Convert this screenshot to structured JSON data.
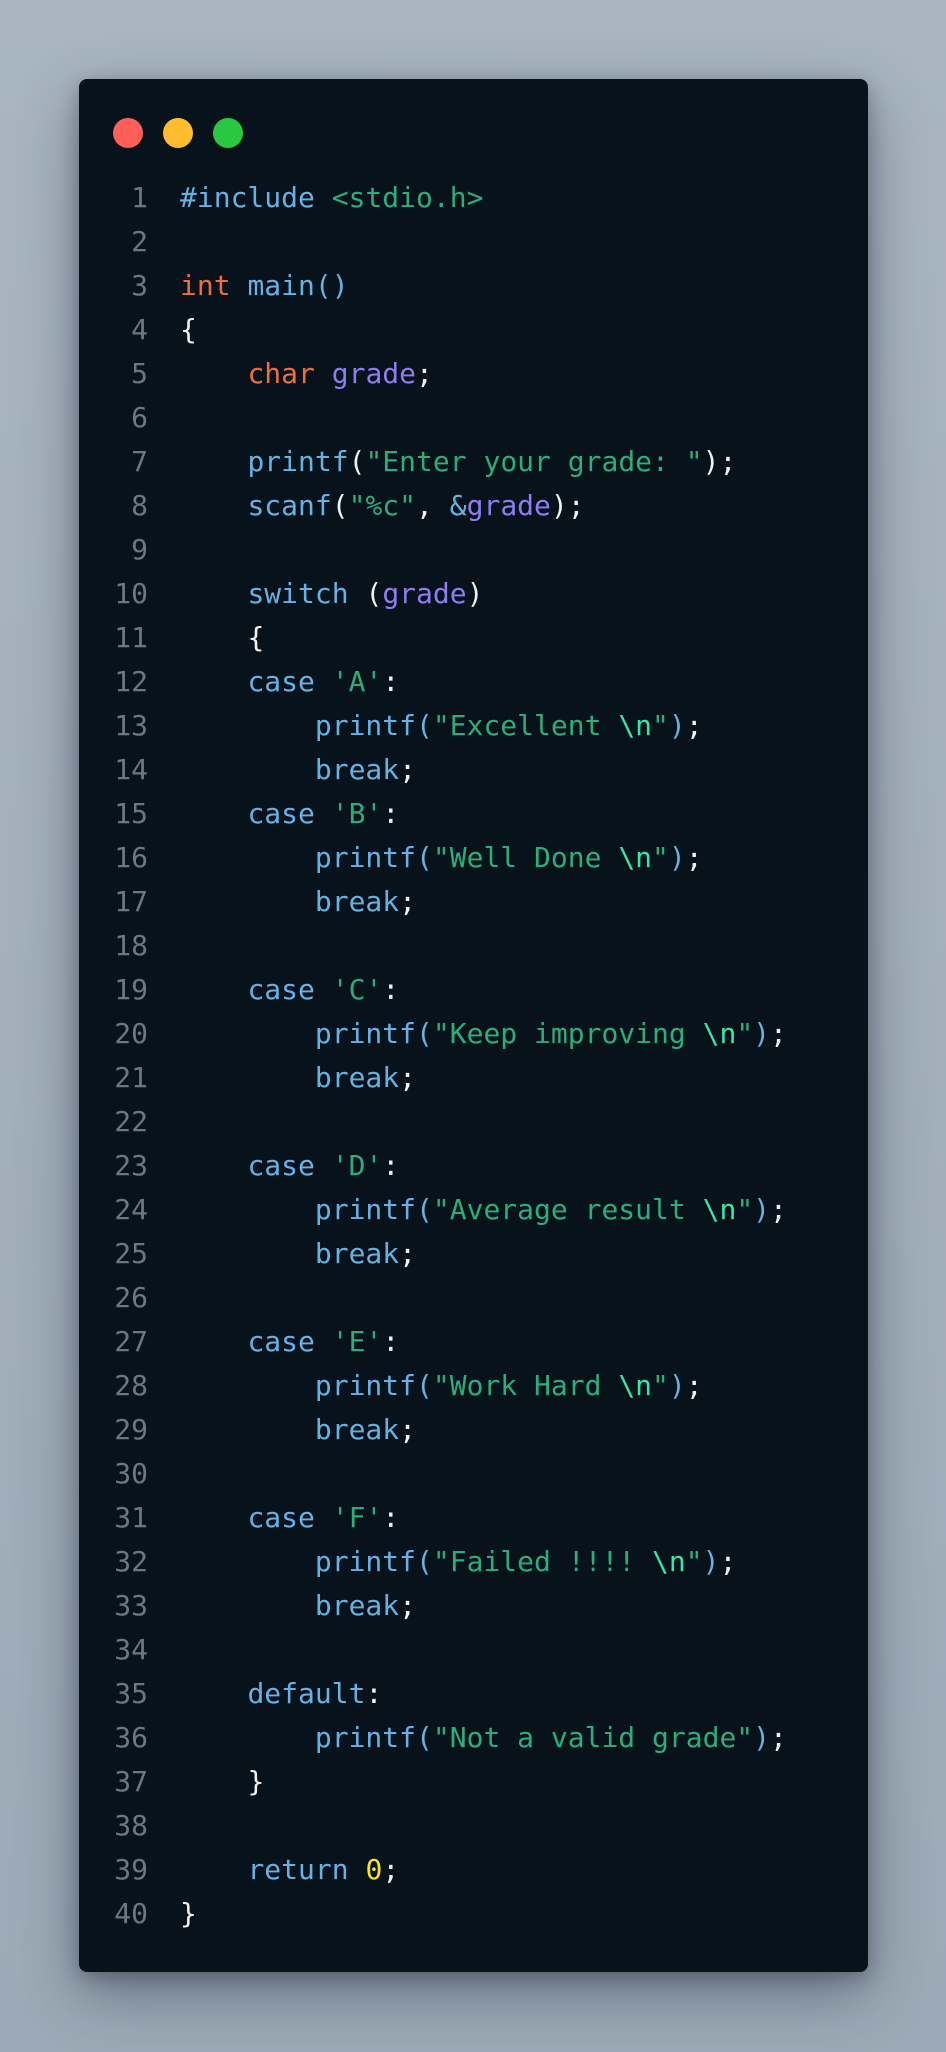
{
  "window": {
    "controls": {
      "close_color": "#ff5f57",
      "minimize_color": "#febc2e",
      "maximize_color": "#28c840"
    }
  },
  "code": {
    "language": "c",
    "lines": [
      {
        "n": "1",
        "tokens": [
          {
            "t": "pp",
            "v": "#include "
          },
          {
            "t": "hdr",
            "v": "<stdio.h>"
          }
        ]
      },
      {
        "n": "2",
        "tokens": []
      },
      {
        "n": "3",
        "tokens": [
          {
            "t": "type",
            "v": "int"
          },
          {
            "t": "plain",
            "v": " "
          },
          {
            "t": "fn",
            "v": "main"
          },
          {
            "t": "paren",
            "v": "()"
          }
        ]
      },
      {
        "n": "4",
        "tokens": [
          {
            "t": "punc",
            "v": "{"
          }
        ]
      },
      {
        "n": "5",
        "tokens": [
          {
            "t": "plain",
            "v": "    "
          },
          {
            "t": "type",
            "v": "char"
          },
          {
            "t": "plain",
            "v": " "
          },
          {
            "t": "var",
            "v": "grade"
          },
          {
            "t": "punc",
            "v": ";"
          }
        ]
      },
      {
        "n": "6",
        "tokens": []
      },
      {
        "n": "7",
        "tokens": [
          {
            "t": "plain",
            "v": "    "
          },
          {
            "t": "fn",
            "v": "printf"
          },
          {
            "t": "punc",
            "v": "("
          },
          {
            "t": "str",
            "v": "\"Enter your grade: \""
          },
          {
            "t": "punc",
            "v": ");"
          }
        ]
      },
      {
        "n": "8",
        "tokens": [
          {
            "t": "plain",
            "v": "    "
          },
          {
            "t": "fn",
            "v": "scanf"
          },
          {
            "t": "punc",
            "v": "("
          },
          {
            "t": "str",
            "v": "\"%c\""
          },
          {
            "t": "punc",
            "v": ", "
          },
          {
            "t": "pp",
            "v": "&"
          },
          {
            "t": "var",
            "v": "grade"
          },
          {
            "t": "punc",
            "v": ");"
          }
        ]
      },
      {
        "n": "9",
        "tokens": []
      },
      {
        "n": "10",
        "tokens": [
          {
            "t": "plain",
            "v": "    "
          },
          {
            "t": "kw",
            "v": "switch"
          },
          {
            "t": "plain",
            "v": " "
          },
          {
            "t": "punc",
            "v": "("
          },
          {
            "t": "var",
            "v": "grade"
          },
          {
            "t": "punc",
            "v": ")"
          }
        ]
      },
      {
        "n": "11",
        "tokens": [
          {
            "t": "plain",
            "v": "    "
          },
          {
            "t": "punc",
            "v": "{"
          }
        ]
      },
      {
        "n": "12",
        "tokens": [
          {
            "t": "plain",
            "v": "    "
          },
          {
            "t": "kw",
            "v": "case"
          },
          {
            "t": "plain",
            "v": " "
          },
          {
            "t": "str",
            "v": "'A'"
          },
          {
            "t": "punc",
            "v": ":"
          }
        ]
      },
      {
        "n": "13",
        "tokens": [
          {
            "t": "plain",
            "v": "        "
          },
          {
            "t": "fn",
            "v": "printf"
          },
          {
            "t": "paren",
            "v": "("
          },
          {
            "t": "str",
            "v": "\"Excellent "
          },
          {
            "t": "esc",
            "v": "\\n"
          },
          {
            "t": "str",
            "v": "\""
          },
          {
            "t": "paren",
            "v": ")"
          },
          {
            "t": "punc",
            "v": ";"
          }
        ]
      },
      {
        "n": "14",
        "tokens": [
          {
            "t": "plain",
            "v": "        "
          },
          {
            "t": "kw",
            "v": "break"
          },
          {
            "t": "punc",
            "v": ";"
          }
        ]
      },
      {
        "n": "15",
        "tokens": [
          {
            "t": "plain",
            "v": "    "
          },
          {
            "t": "kw",
            "v": "case"
          },
          {
            "t": "plain",
            "v": " "
          },
          {
            "t": "str",
            "v": "'B'"
          },
          {
            "t": "punc",
            "v": ":"
          }
        ]
      },
      {
        "n": "16",
        "tokens": [
          {
            "t": "plain",
            "v": "        "
          },
          {
            "t": "fn",
            "v": "printf"
          },
          {
            "t": "paren",
            "v": "("
          },
          {
            "t": "str",
            "v": "\"Well Done "
          },
          {
            "t": "esc",
            "v": "\\n"
          },
          {
            "t": "str",
            "v": "\""
          },
          {
            "t": "paren",
            "v": ")"
          },
          {
            "t": "punc",
            "v": ";"
          }
        ]
      },
      {
        "n": "17",
        "tokens": [
          {
            "t": "plain",
            "v": "        "
          },
          {
            "t": "kw",
            "v": "break"
          },
          {
            "t": "punc",
            "v": ";"
          }
        ]
      },
      {
        "n": "18",
        "tokens": []
      },
      {
        "n": "19",
        "tokens": [
          {
            "t": "plain",
            "v": "    "
          },
          {
            "t": "kw",
            "v": "case"
          },
          {
            "t": "plain",
            "v": " "
          },
          {
            "t": "str",
            "v": "'C'"
          },
          {
            "t": "punc",
            "v": ":"
          }
        ]
      },
      {
        "n": "20",
        "tokens": [
          {
            "t": "plain",
            "v": "        "
          },
          {
            "t": "fn",
            "v": "printf"
          },
          {
            "t": "paren",
            "v": "("
          },
          {
            "t": "str",
            "v": "\"Keep improving "
          },
          {
            "t": "esc",
            "v": "\\n"
          },
          {
            "t": "str",
            "v": "\""
          },
          {
            "t": "paren",
            "v": ")"
          },
          {
            "t": "punc",
            "v": ";"
          }
        ]
      },
      {
        "n": "21",
        "tokens": [
          {
            "t": "plain",
            "v": "        "
          },
          {
            "t": "kw",
            "v": "break"
          },
          {
            "t": "punc",
            "v": ";"
          }
        ]
      },
      {
        "n": "22",
        "tokens": []
      },
      {
        "n": "23",
        "tokens": [
          {
            "t": "plain",
            "v": "    "
          },
          {
            "t": "kw",
            "v": "case"
          },
          {
            "t": "plain",
            "v": " "
          },
          {
            "t": "str",
            "v": "'D'"
          },
          {
            "t": "punc",
            "v": ":"
          }
        ]
      },
      {
        "n": "24",
        "tokens": [
          {
            "t": "plain",
            "v": "        "
          },
          {
            "t": "fn",
            "v": "printf"
          },
          {
            "t": "paren",
            "v": "("
          },
          {
            "t": "str",
            "v": "\"Average result "
          },
          {
            "t": "esc",
            "v": "\\n"
          },
          {
            "t": "str",
            "v": "\""
          },
          {
            "t": "paren",
            "v": ")"
          },
          {
            "t": "punc",
            "v": ";"
          }
        ]
      },
      {
        "n": "25",
        "tokens": [
          {
            "t": "plain",
            "v": "        "
          },
          {
            "t": "kw",
            "v": "break"
          },
          {
            "t": "punc",
            "v": ";"
          }
        ]
      },
      {
        "n": "26",
        "tokens": []
      },
      {
        "n": "27",
        "tokens": [
          {
            "t": "plain",
            "v": "    "
          },
          {
            "t": "kw",
            "v": "case"
          },
          {
            "t": "plain",
            "v": " "
          },
          {
            "t": "str",
            "v": "'E'"
          },
          {
            "t": "punc",
            "v": ":"
          }
        ]
      },
      {
        "n": "28",
        "tokens": [
          {
            "t": "plain",
            "v": "        "
          },
          {
            "t": "fn",
            "v": "printf"
          },
          {
            "t": "paren",
            "v": "("
          },
          {
            "t": "str",
            "v": "\"Work Hard "
          },
          {
            "t": "esc",
            "v": "\\n"
          },
          {
            "t": "str",
            "v": "\""
          },
          {
            "t": "paren",
            "v": ")"
          },
          {
            "t": "punc",
            "v": ";"
          }
        ]
      },
      {
        "n": "29",
        "tokens": [
          {
            "t": "plain",
            "v": "        "
          },
          {
            "t": "kw",
            "v": "break"
          },
          {
            "t": "punc",
            "v": ";"
          }
        ]
      },
      {
        "n": "30",
        "tokens": []
      },
      {
        "n": "31",
        "tokens": [
          {
            "t": "plain",
            "v": "    "
          },
          {
            "t": "kw",
            "v": "case"
          },
          {
            "t": "plain",
            "v": " "
          },
          {
            "t": "str",
            "v": "'F'"
          },
          {
            "t": "punc",
            "v": ":"
          }
        ]
      },
      {
        "n": "32",
        "tokens": [
          {
            "t": "plain",
            "v": "        "
          },
          {
            "t": "fn",
            "v": "printf"
          },
          {
            "t": "paren",
            "v": "("
          },
          {
            "t": "str",
            "v": "\"Failed !!!! "
          },
          {
            "t": "esc",
            "v": "\\n"
          },
          {
            "t": "str",
            "v": "\""
          },
          {
            "t": "paren",
            "v": ")"
          },
          {
            "t": "punc",
            "v": ";"
          }
        ]
      },
      {
        "n": "33",
        "tokens": [
          {
            "t": "plain",
            "v": "        "
          },
          {
            "t": "kw",
            "v": "break"
          },
          {
            "t": "punc",
            "v": ";"
          }
        ]
      },
      {
        "n": "34",
        "tokens": []
      },
      {
        "n": "35",
        "tokens": [
          {
            "t": "plain",
            "v": "    "
          },
          {
            "t": "kw",
            "v": "default"
          },
          {
            "t": "punc",
            "v": ":"
          }
        ]
      },
      {
        "n": "36",
        "tokens": [
          {
            "t": "plain",
            "v": "        "
          },
          {
            "t": "fn",
            "v": "printf"
          },
          {
            "t": "paren",
            "v": "("
          },
          {
            "t": "str",
            "v": "\"Not a valid grade\""
          },
          {
            "t": "paren",
            "v": ")"
          },
          {
            "t": "punc",
            "v": ";"
          }
        ]
      },
      {
        "n": "37",
        "tokens": [
          {
            "t": "plain",
            "v": "    "
          },
          {
            "t": "punc",
            "v": "}"
          }
        ]
      },
      {
        "n": "38",
        "tokens": []
      },
      {
        "n": "39",
        "tokens": [
          {
            "t": "plain",
            "v": "    "
          },
          {
            "t": "kw",
            "v": "return"
          },
          {
            "t": "plain",
            "v": " "
          },
          {
            "t": "num",
            "v": "0"
          },
          {
            "t": "punc",
            "v": ";"
          }
        ]
      },
      {
        "n": "40",
        "tokens": [
          {
            "t": "punc",
            "v": "}"
          }
        ]
      }
    ]
  }
}
